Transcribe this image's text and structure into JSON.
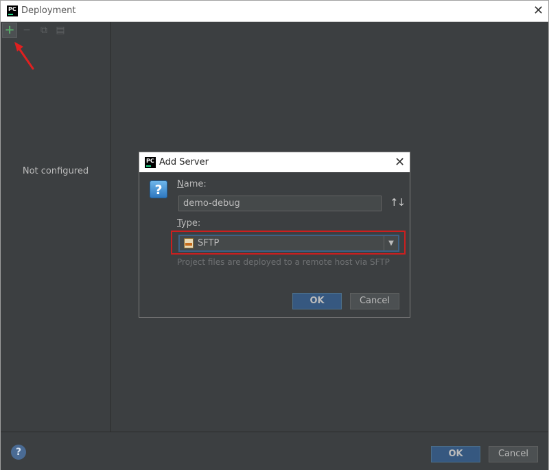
{
  "window": {
    "title": "Deployment",
    "logo": "PC",
    "close_glyph": "✕"
  },
  "toolbar": {
    "add_glyph": "+",
    "remove_glyph": "−",
    "copy_glyph": "⧉",
    "other_glyph": "▤"
  },
  "left_panel": {
    "empty_text": "Not configured"
  },
  "footer": {
    "help_glyph": "?",
    "ok_label": "OK",
    "cancel_label": "Cancel"
  },
  "dialog": {
    "title": "Add Server",
    "logo": "PC",
    "close_glyph": "✕",
    "question_glyph": "?",
    "name_label_mnemonic": "N",
    "name_label_rest": "ame:",
    "name_value": "demo-debug",
    "sort_glyph": "↑↓",
    "type_label_mnemonic": "T",
    "type_label_rest": "ype:",
    "type_value": "SFTP",
    "dropdown_glyph": "▼",
    "type_description": "Project files are deployed to a remote host via SFTP",
    "ok_label": "OK",
    "cancel_label": "Cancel"
  },
  "colors": {
    "background": "#3c3f41",
    "titlebar": "#ffffff",
    "primary_button": "#365880",
    "add_icon": "#59a869",
    "highlight_box": "#cc1f1f",
    "annotation_arrow": "#e02020"
  },
  "icons": [
    "pycharm-logo-icon",
    "close-icon",
    "add-icon",
    "remove-icon",
    "copy-icon",
    "help-icon",
    "question-icon",
    "sort-icon",
    "sftp-icon",
    "dropdown-arrow-icon",
    "annotation-arrow-icon"
  ]
}
